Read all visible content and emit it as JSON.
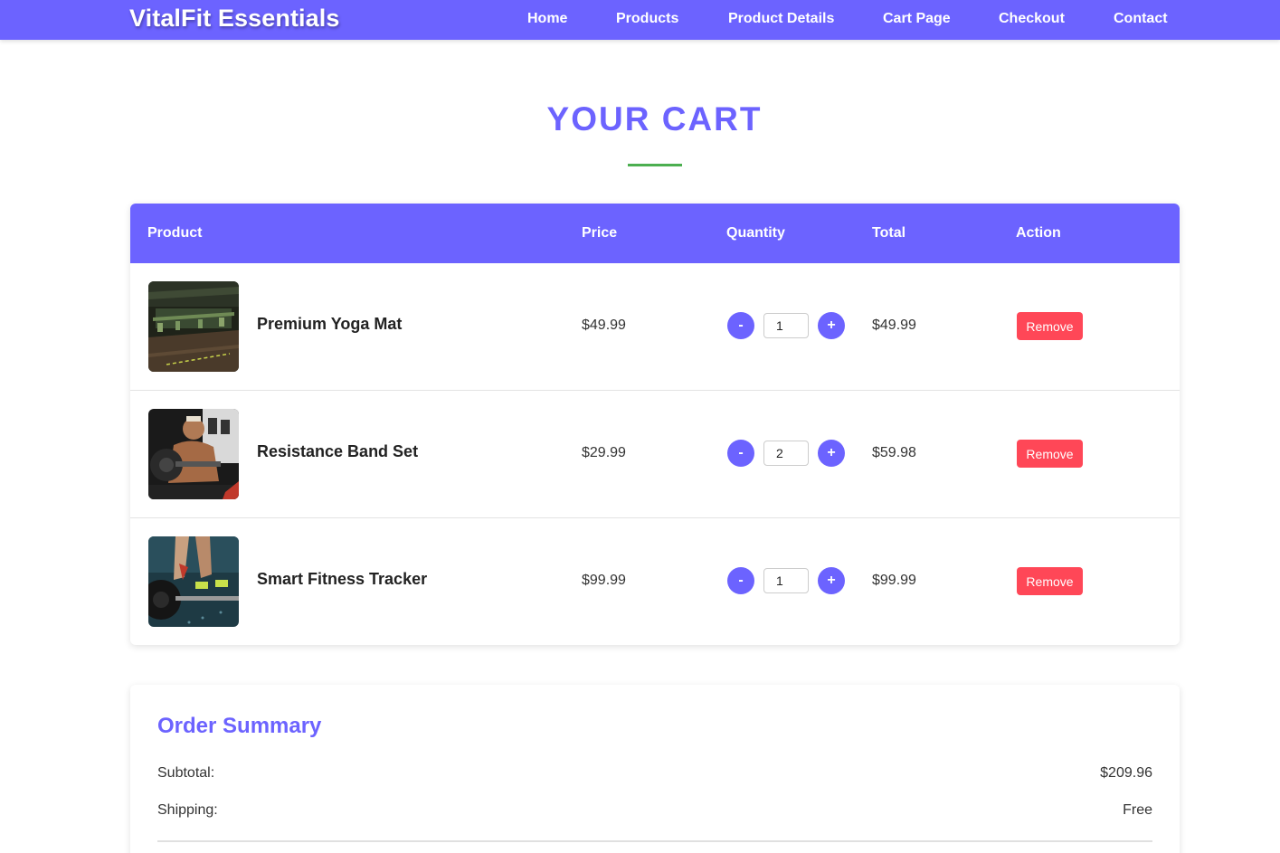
{
  "brand": "VitalFit Essentials",
  "nav": {
    "home": "Home",
    "products": "Products",
    "product_details": "Product Details",
    "cart_page": "Cart Page",
    "checkout": "Checkout",
    "contact": "Contact"
  },
  "page_title": "YOUR CART",
  "table": {
    "headers": {
      "product": "Product",
      "price": "Price",
      "quantity": "Quantity",
      "total": "Total",
      "action": "Action"
    },
    "rows": [
      {
        "name": "Premium Yoga Mat",
        "price": "$49.99",
        "quantity": "1",
        "total": "$49.99",
        "image": "gym-interior-photo"
      },
      {
        "name": "Resistance Band Set",
        "price": "$29.99",
        "quantity": "2",
        "total": "$59.98",
        "image": "athlete-weightlifting-photo"
      },
      {
        "name": "Smart Fitness Tracker",
        "price": "$99.99",
        "quantity": "1",
        "total": "$99.99",
        "image": "barbell-deadlift-photo"
      }
    ],
    "minus_label": "-",
    "plus_label": "+",
    "remove_label": "Remove"
  },
  "summary": {
    "title": "Order Summary",
    "subtotal_label": "Subtotal:",
    "subtotal_value": "$209.96",
    "shipping_label": "Shipping:",
    "shipping_value": "Free"
  },
  "colors": {
    "primary": "#6c63ff",
    "accent_green": "#4caf50",
    "remove_red": "#ff4757"
  }
}
